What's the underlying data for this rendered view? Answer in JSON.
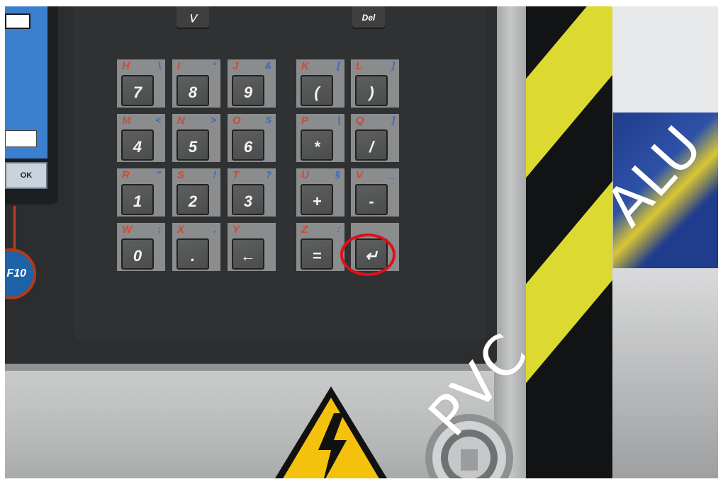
{
  "screen": {
    "ok_label": "OK",
    "f10_label": "F10"
  },
  "top_keys": {
    "down": "⋁",
    "del": "Del"
  },
  "keypad": [
    {
      "alpha": "H",
      "sym": "\\",
      "key": "7"
    },
    {
      "alpha": "I",
      "sym": "°",
      "key": "8"
    },
    {
      "alpha": "J",
      "sym": "&",
      "key": "9"
    },
    {
      "alpha": "K",
      "sym": "[",
      "key": "("
    },
    {
      "alpha": "L",
      "sym": "]",
      "key": ")"
    },
    {
      "alpha": "M",
      "sym": "<",
      "key": "4"
    },
    {
      "alpha": "N",
      "sym": ">",
      "key": "5"
    },
    {
      "alpha": "O",
      "sym": "S",
      "key": "6"
    },
    {
      "alpha": "P",
      "sym": "|",
      "key": "*"
    },
    {
      "alpha": "Q",
      "sym": "]",
      "key": "/"
    },
    {
      "alpha": "R",
      "sym": "\"",
      "key": "1"
    },
    {
      "alpha": "S",
      "sym": "!",
      "key": "2"
    },
    {
      "alpha": "T",
      "sym": "?",
      "key": "3"
    },
    {
      "alpha": "U",
      "sym": "§",
      "key": "+"
    },
    {
      "alpha": "V",
      "sym": "_",
      "key": "-"
    },
    {
      "alpha": "W",
      "sym": ";",
      "key": "0"
    },
    {
      "alpha": "X",
      "sym": ",",
      "key": "."
    },
    {
      "alpha": "Y",
      "sym": "",
      "key": "←"
    },
    {
      "alpha": "Z",
      "sym": ":",
      "key": "="
    },
    {
      "alpha": "",
      "sym": "",
      "key": "↵"
    }
  ],
  "labels": {
    "pvc": "PVC",
    "alu": "ALU"
  },
  "icons": {
    "warning": "high-voltage-warning-icon",
    "lock": "key-lock-icon",
    "enter": "enter-key-icon"
  },
  "colors": {
    "highlight_circle": "#e0101a",
    "hazard_yellow": "#dcd930",
    "alpha_red": "#d24a30",
    "symbol_blue": "#2e6bc8"
  }
}
